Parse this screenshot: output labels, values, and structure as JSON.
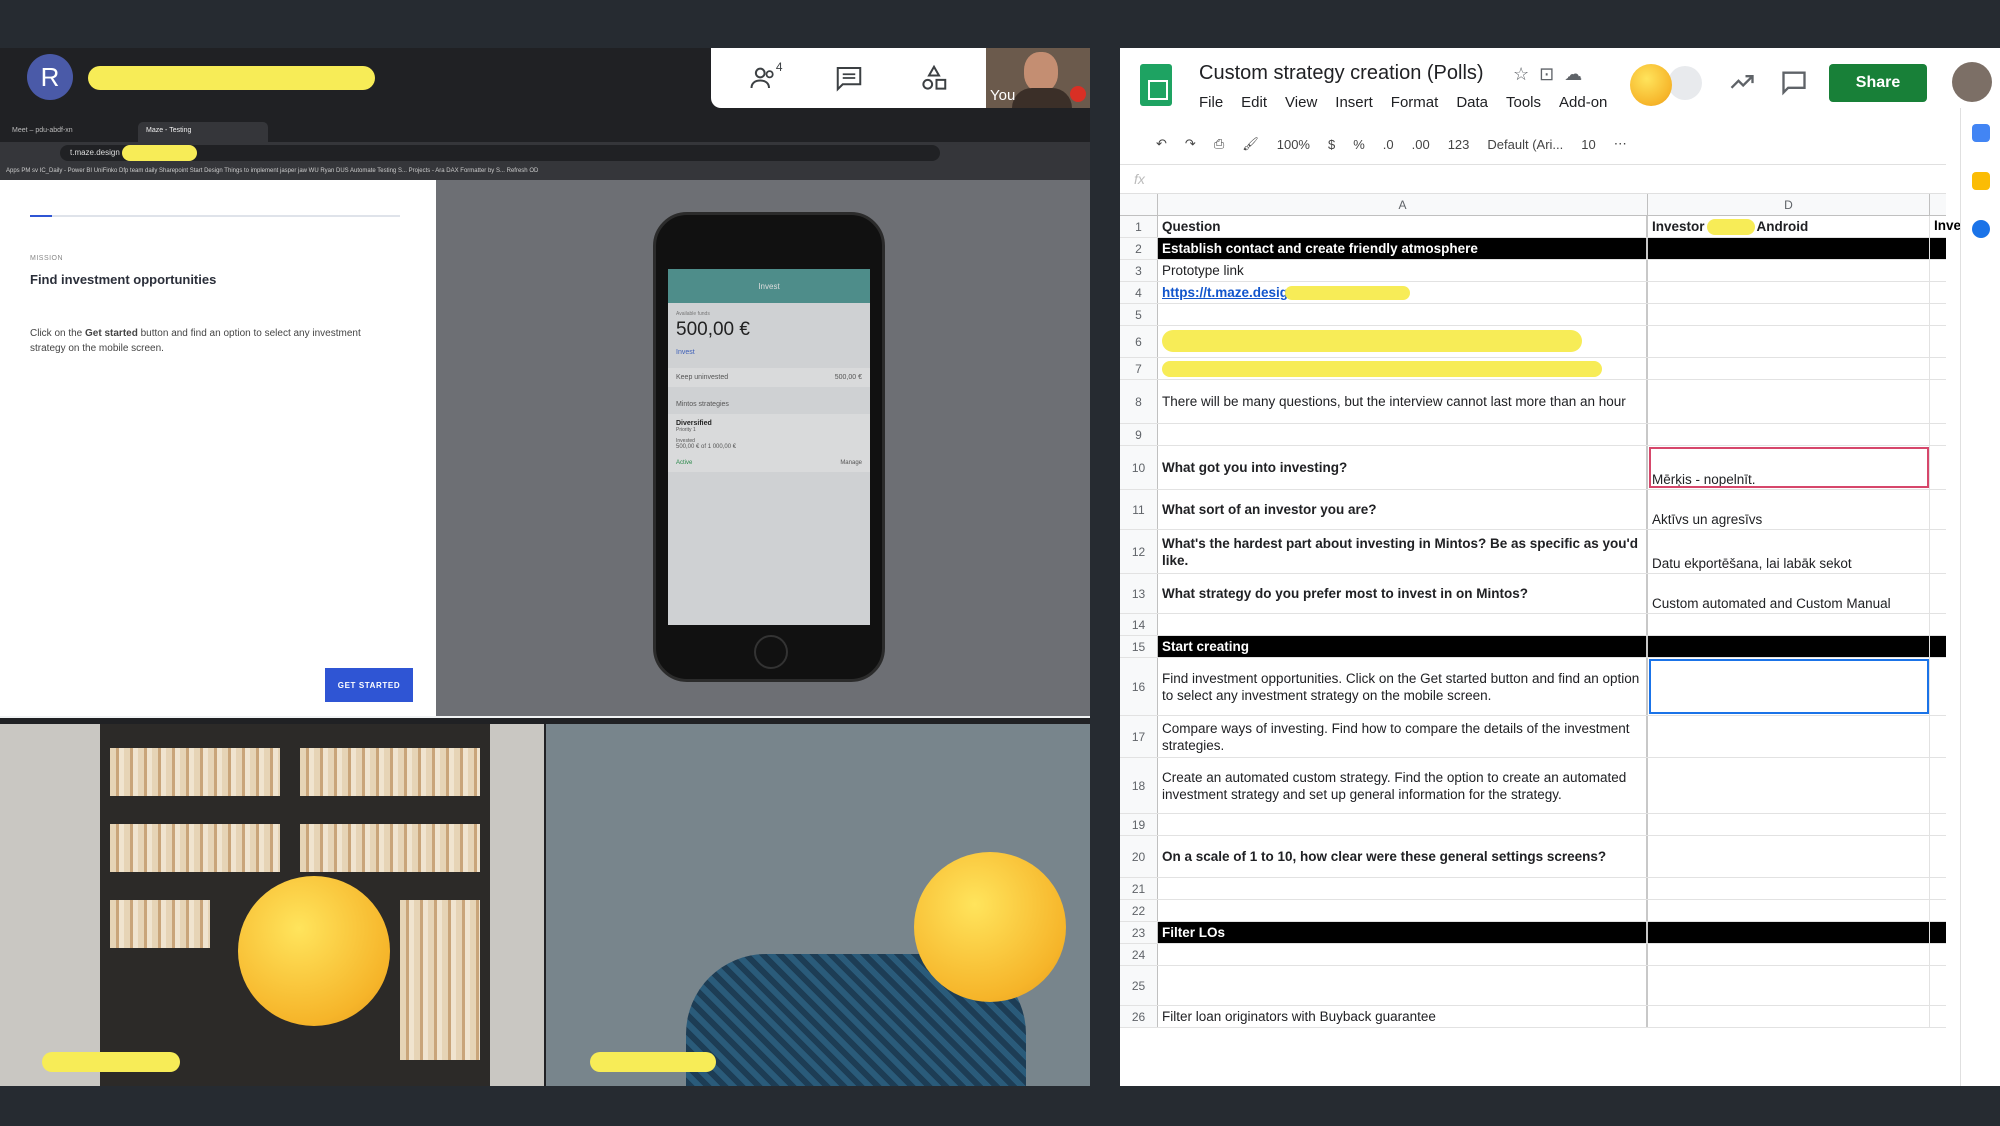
{
  "meet": {
    "presenter_initial": "R",
    "people_count": "4",
    "self_label": "You",
    "shared_browser": {
      "tabs": [
        "Meet – pdu-abdf-xn",
        "Maze - Testing"
      ],
      "url": "t.maze.design",
      "bookmarks": "Apps  PM  sv  IC_Daily - Power BI  UniFinko  Dfp  team  daily  Sharepoint  Start Design  Things to implement  jasper  jaw  WU  Ryan  DUS  Automate Testing S...  Projects - Ara  DAX Formatter by S...  Refresh  OD"
    },
    "maze": {
      "mission_kicker": "MISSION",
      "mission_title": "Find investment opportunities",
      "mission_text_pre": "Click on the ",
      "mission_text_bold": "Get started",
      "mission_text_post": " button and find an option to select any investment strategy on the mobile screen.",
      "progress": 0.06,
      "get_started": "GET STARTED"
    },
    "phone_app": {
      "header": "Invest",
      "balance_label": "Available funds",
      "balance": "500,00 €",
      "invest_link": "Invest",
      "keep_uninvested": "Keep uninvested",
      "keep_value": "500,00 €",
      "strategies_title": "Mintos strategies",
      "strategy_name": "Diversified",
      "strategy_priority": "Priority 1",
      "invested_label": "Invested",
      "invested_value": "500,00 € of 1 000,00 €",
      "status": "Active",
      "manage": "Manage"
    }
  },
  "sheets": {
    "title": "Custom strategy creation (Polls)",
    "menu": [
      "File",
      "Edit",
      "View",
      "Insert",
      "Format",
      "Data",
      "Tools",
      "Add-on"
    ],
    "share_label": "Share",
    "toolbar": {
      "zoom": "100%",
      "currency": "$",
      "percent": "%",
      "dec_less": ".0",
      "dec_more": ".00",
      "number_format": "123",
      "font": "Default (Ari...",
      "font_size": "10"
    },
    "fx": "fx",
    "columns": [
      "A",
      "D"
    ],
    "rows": [
      {
        "n": "1",
        "a": "Question",
        "d": "Investor",
        "d2": "Android",
        "e": "Inve",
        "type": "header"
      },
      {
        "n": "2",
        "a": "Establish contact and create friendly atmosphere",
        "d": "",
        "type": "section"
      },
      {
        "n": "3",
        "a": "Prototype link",
        "d": "",
        "type": "normal"
      },
      {
        "n": "4",
        "a": "https://t.maze.design.",
        "d": "",
        "type": "link"
      },
      {
        "n": "5",
        "a": "",
        "d": "",
        "type": "normal"
      },
      {
        "n": "6",
        "a": "",
        "d": "",
        "type": "normal"
      },
      {
        "n": "7",
        "a": "",
        "d": "",
        "type": "normal"
      },
      {
        "n": "8",
        "a": "There will be many questions, but the interview cannot last more than an hour",
        "d": "",
        "type": "normal"
      },
      {
        "n": "9",
        "a": "",
        "d": "",
        "type": "normal"
      },
      {
        "n": "10",
        "a": "What got you into investing?",
        "d": "Mērķis - nopelnīt.",
        "type": "bold"
      },
      {
        "n": "11",
        "a": "What sort of an investor you are?",
        "d": "Aktīvs un agresīvs",
        "type": "bold"
      },
      {
        "n": "12",
        "a": "What's the hardest part about investing in Mintos? Be as specific as you'd like.",
        "d": "Datu ekportēšana, lai labāk sekot",
        "type": "bold"
      },
      {
        "n": "13",
        "a": "What strategy do you prefer most to invest in on Mintos?",
        "d": "Custom automated and Custom Manual",
        "type": "bold"
      },
      {
        "n": "14",
        "a": "",
        "d": "",
        "type": "normal"
      },
      {
        "n": "15",
        "a": "Start creating",
        "d": "",
        "type": "section"
      },
      {
        "n": "16",
        "a": "Find investment opportunities. Click on the Get started button and find an option to select any investment strategy on the mobile screen.",
        "d": "",
        "type": "normal"
      },
      {
        "n": "17",
        "a": "Compare ways of investing. Find how to compare the details of the investment strategies.",
        "d": "",
        "type": "normal"
      },
      {
        "n": "18",
        "a": "Create an automated custom strategy. Find the option to create an automated investment strategy and set up general information for the strategy.",
        "d": "",
        "type": "normal"
      },
      {
        "n": "19",
        "a": "",
        "d": "",
        "type": "normal"
      },
      {
        "n": "20",
        "a": "On a scale of 1 to 10, how clear were these general settings screens?",
        "d": "",
        "type": "bold"
      },
      {
        "n": "21",
        "a": "",
        "d": "",
        "type": "normal"
      },
      {
        "n": "22",
        "a": "",
        "d": "",
        "type": "normal"
      },
      {
        "n": "23",
        "a": "Filter LOs",
        "d": "",
        "type": "section"
      },
      {
        "n": "24",
        "a": "",
        "d": "",
        "type": "normal"
      },
      {
        "n": "25",
        "a": "",
        "d": "",
        "type": "normal"
      },
      {
        "n": "26",
        "a": "Filter loan originators with Buyback guarantee",
        "d": "",
        "type": "normal"
      }
    ]
  },
  "colors": {
    "meet_bg": "#202124",
    "redaction": "#f7ec57",
    "maze_blue": "#2f55d4",
    "sheets_green": "#188038",
    "section_bg": "#000000"
  }
}
